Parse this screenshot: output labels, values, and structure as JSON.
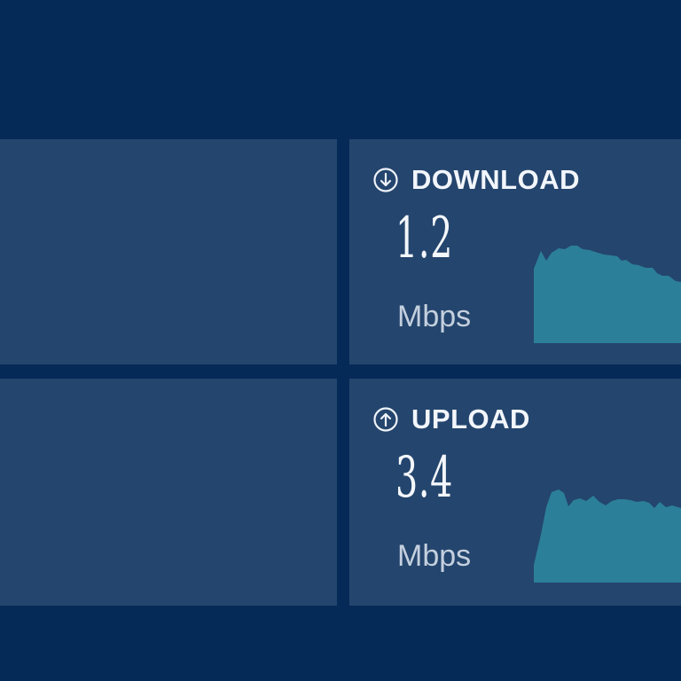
{
  "metrics": {
    "download": {
      "icon": "arrow-down-circle-icon",
      "label": "DOWNLOAD",
      "value": "1.2",
      "unit": "Mbps"
    },
    "upload": {
      "icon": "arrow-up-circle-icon",
      "label": "UPLOAD",
      "value": "3.4",
      "unit": "Mbps"
    }
  },
  "colors": {
    "background": "#062a57",
    "panel": "#24456d",
    "text": "#f2f6fb",
    "unit_text": "#c4d0de",
    "sparkline_fill": "#2c7f99"
  }
}
